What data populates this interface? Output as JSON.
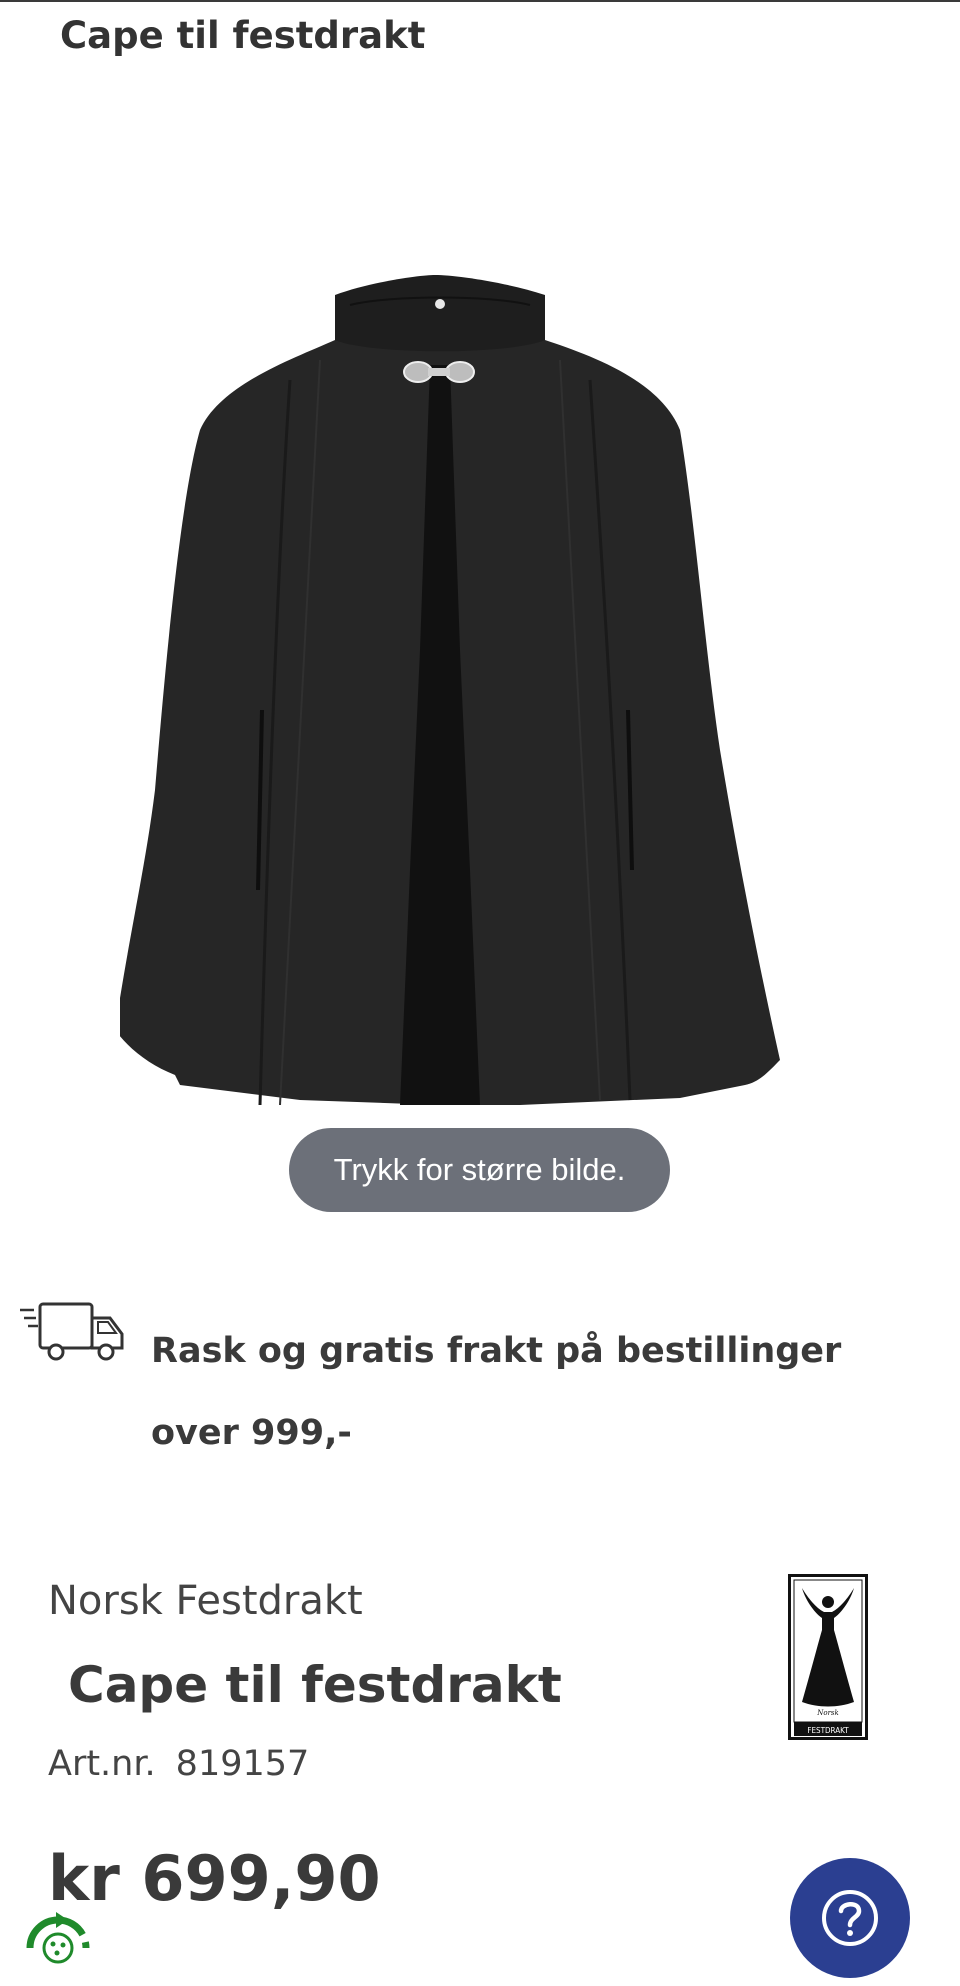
{
  "header": {
    "title": "Cape til festdrakt"
  },
  "gallery": {
    "zoom_hint": "Trykk for større bilde."
  },
  "shipping": {
    "icon": "delivery-truck-icon",
    "message": "Rask og gratis frakt på bestillinger over 999,-"
  },
  "product": {
    "brand": "Norsk Festdrakt",
    "name": "Cape til festdrakt",
    "art_label": "Art.nr.",
    "art_number": "819157",
    "price": "kr 699,90"
  },
  "brand_logo": {
    "script_text": "Norsk",
    "caption": "FESTDRAKT"
  },
  "help": {
    "icon": "question-mark-icon"
  },
  "colors": {
    "text": "#3a3a3a",
    "zoom_hint_bg": "#6c7079",
    "help_button_bg": "#2b3f91",
    "eco_green": "#1f8a2b"
  }
}
